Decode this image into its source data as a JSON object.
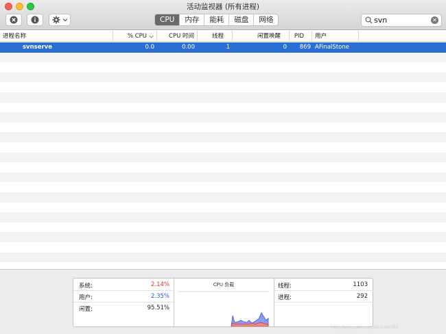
{
  "window": {
    "title": "活动监视器 (所有进程)"
  },
  "toolbar": {
    "tabs": [
      {
        "label": "CPU",
        "active": true
      },
      {
        "label": "内存",
        "active": false
      },
      {
        "label": "能耗",
        "active": false
      },
      {
        "label": "磁盘",
        "active": false
      },
      {
        "label": "网络",
        "active": false
      }
    ],
    "search_value": "svn"
  },
  "table": {
    "headers": {
      "name": "进程名称",
      "cpu_pct": "% CPU",
      "cpu_time": "CPU 时间",
      "threads": "线程",
      "idle_wake": "闲置唤醒",
      "pid": "PID",
      "user": "用户"
    },
    "rows": [
      {
        "name": "svnserve",
        "cpu_pct": "0.0",
        "cpu_time": "0.00",
        "threads": "1",
        "idle_wake": "0",
        "pid": "869",
        "user": "AFinalStone"
      }
    ]
  },
  "summary": {
    "system_label": "系统:",
    "system_value": "2.14%",
    "user_label": "用户:",
    "user_value": "2.35%",
    "idle_label": "闲置:",
    "idle_value": "95.51%",
    "cpu_load_title": "CPU 负载",
    "threads_label": "线程:",
    "threads_value": "1103",
    "processes_label": "进程:",
    "processes_value": "292"
  },
  "colors": {
    "selection": "#2a6fd6",
    "system": "#e0302a",
    "user": "#2f57d9"
  },
  "icons": [
    "stop-process-icon",
    "info-icon",
    "gear-icon",
    "chevron-down-icon",
    "search-icon",
    "clear-search-icon",
    "sort-descending-icon"
  ],
  "watermark": "http://blog.csdn.net/abc6368765"
}
